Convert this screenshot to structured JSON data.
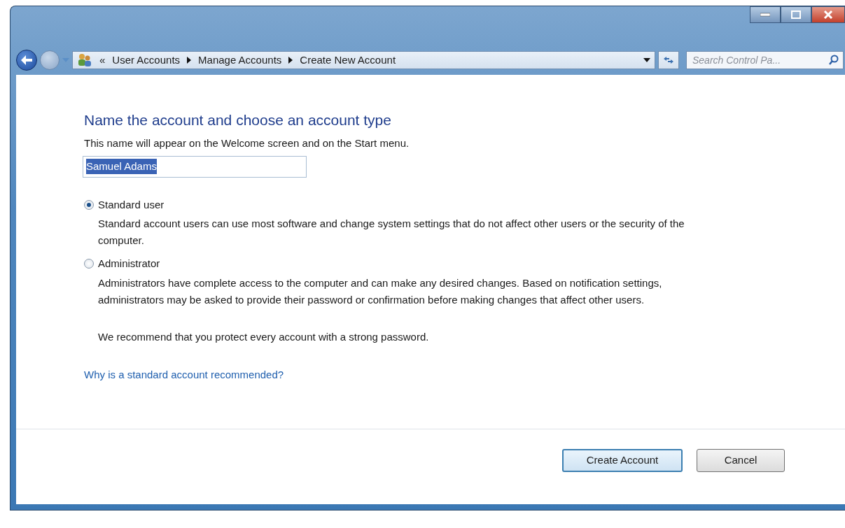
{
  "window": {
    "controls": [
      {
        "kind": "minimize"
      },
      {
        "kind": "maximize"
      },
      {
        "kind": "close"
      }
    ]
  },
  "address_bar": {
    "overflow": "«",
    "path": [
      "User Accounts",
      "Manage Accounts",
      "Create New Account"
    ]
  },
  "search": {
    "placeholder": "Search Control Pa..."
  },
  "heading": "Name the account and choose an account type",
  "subtitle": "This name will appear on the Welcome screen and on the Start menu.",
  "name_field": {
    "value": "Samuel Adams",
    "value_selected": true
  },
  "account_types": [
    {
      "label": "Standard user",
      "selected": true,
      "description": "Standard account users can use most software and change system settings that do not affect other users or the security of the computer."
    },
    {
      "label": "Administrator",
      "selected": false,
      "description": "Administrators have complete access to the computer and can make any desired changes. Based on notification settings, administrators may be asked to provide their password or confirmation before making changes that affect other users."
    }
  ],
  "note": "We recommend that you protect every account with a strong password.",
  "help_link": "Why is a standard account recommended?",
  "buttons": [
    {
      "label": "Create Account",
      "default": true
    },
    {
      "label": "Cancel",
      "default": false
    }
  ]
}
